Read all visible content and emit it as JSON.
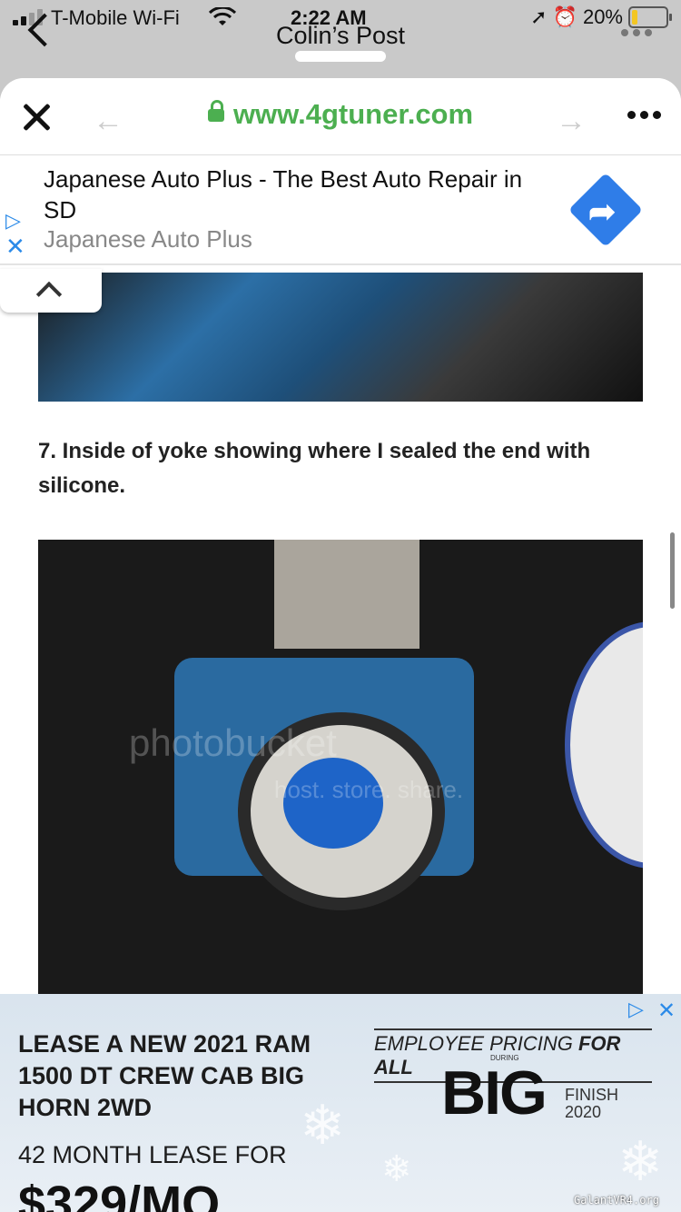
{
  "status_bar": {
    "carrier": "T-Mobile Wi-Fi",
    "time": "2:22 AM",
    "battery": "20%"
  },
  "parent_page": {
    "title": "Colin’s Post"
  },
  "browser": {
    "url": "www.4gtuner.com",
    "back_arrow": "←",
    "forward_arrow": "→"
  },
  "top_ad": {
    "title": "Japanese Auto Plus - The Best Auto Repair in SD",
    "advertiser": "Japanese Auto Plus"
  },
  "article": {
    "caption": "7. Inside of yoke showing where I sealed the end with silicone.",
    "photo_watermark": "photobucket",
    "photo_watermark_sub": "host. store. share."
  },
  "bottom_ad": {
    "headline": "LEASE A NEW 2021 RAM 1500 DT CREW CAB BIG HORN 2WD",
    "lease_line": "42 MONTH LEASE FOR",
    "price": "$329/MO",
    "employee_pricing": "EMPLOYEE PRICING",
    "for_all": "FOR ALL",
    "during": "DURING",
    "big": "BIG",
    "finish": "FINISH",
    "year": "2020"
  },
  "watermark": "GalantVR4.org"
}
